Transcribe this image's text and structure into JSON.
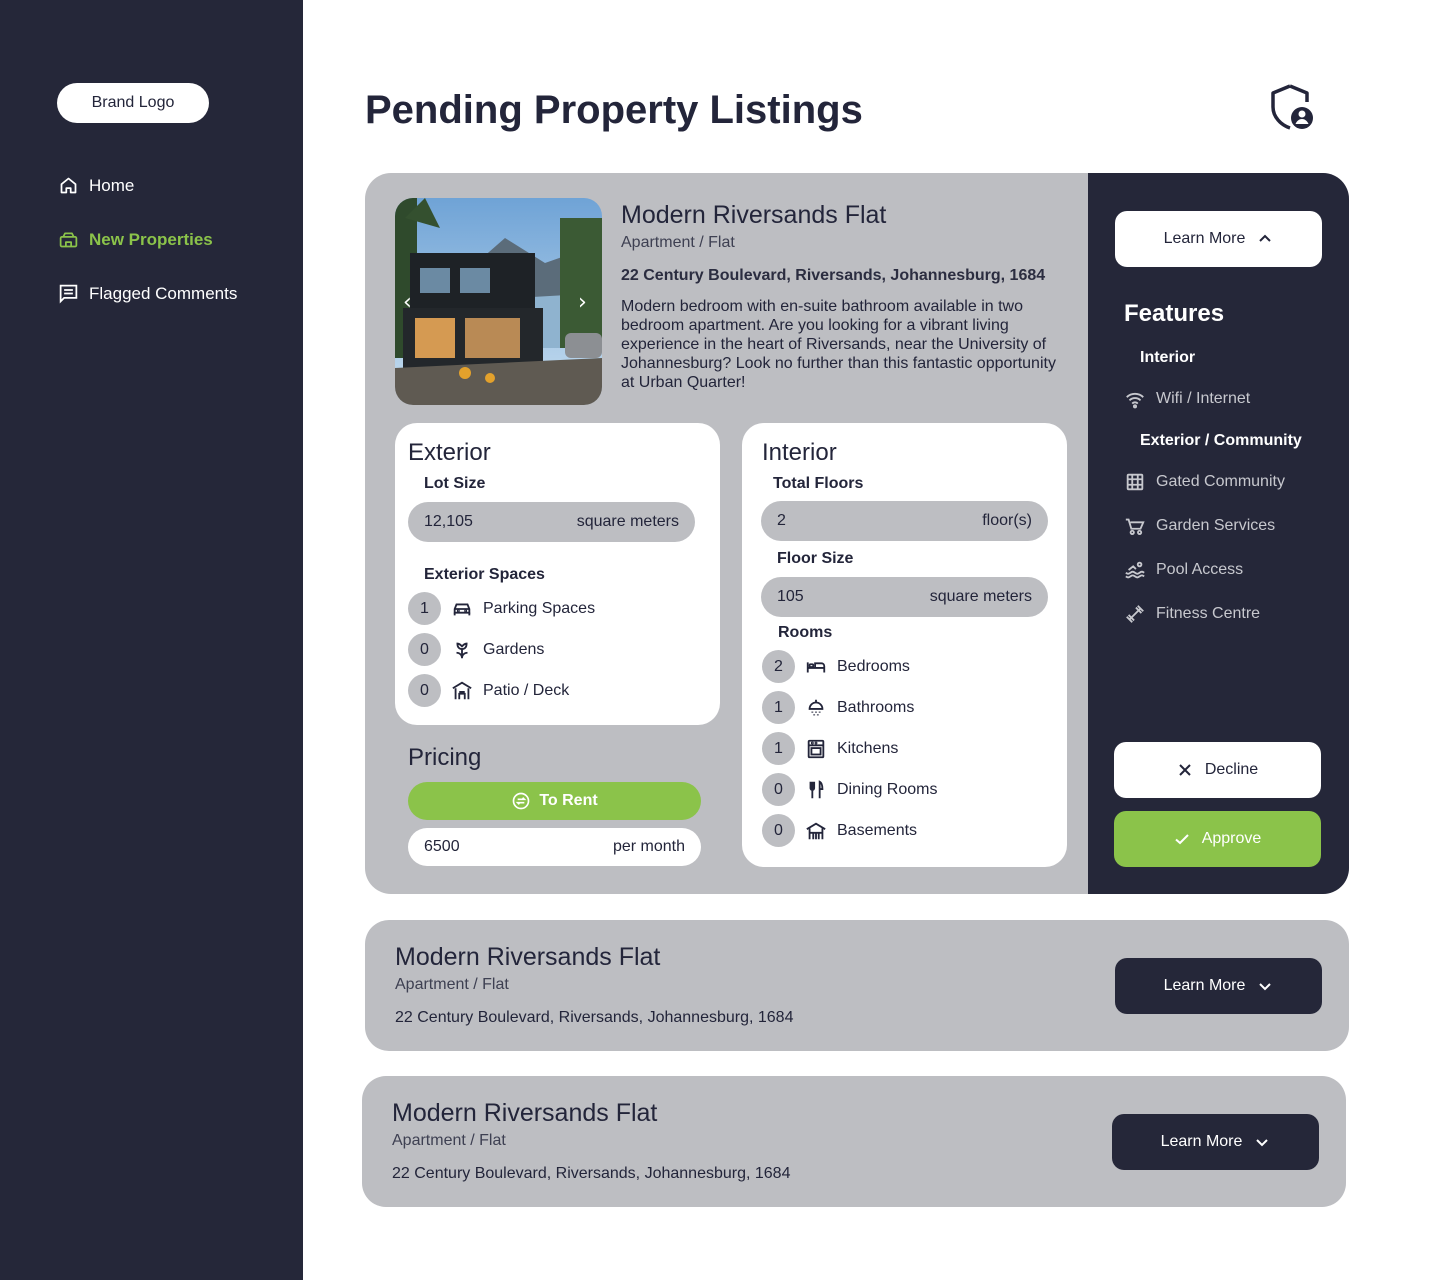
{
  "sidebar": {
    "brand_logo": "Brand Logo",
    "nav": [
      {
        "label": "Home",
        "icon": "home-icon",
        "active": false
      },
      {
        "label": "New Properties",
        "icon": "new-properties-icon",
        "active": true
      },
      {
        "label": "Flagged Comments",
        "icon": "comments-icon",
        "active": false
      }
    ]
  },
  "header": {
    "title": "Pending Property Listings",
    "admin_icon": "shield-user-icon"
  },
  "colors": {
    "sidebar_bg": "#252739",
    "accent_green": "#8bc34a",
    "card_bg": "#bdbec2",
    "text_dark": "#23253a"
  },
  "listing": {
    "title": "Modern Riversands Flat",
    "type": "Apartment / Flat",
    "address": "22 Century Boulevard, Riversands, Johannesburg, 1684",
    "description": "Modern bedroom with en-suite bathroom available in two bedroom apartment. Are you looking for a vibrant living experience in the  heart of Riversands, near the University of Johannesburg? Look no further than this fantastic opportunity at Urban Quarter!",
    "learn_more": "Learn More",
    "exterior": {
      "title": "Exterior",
      "lot_size_label": "Lot Size",
      "lot_size_value": "12,105",
      "lot_size_unit": "square meters",
      "spaces_label": "Exterior Spaces",
      "spaces": [
        {
          "count": "1",
          "label": "Parking Spaces",
          "icon": "car-icon"
        },
        {
          "count": "0",
          "label": "Gardens",
          "icon": "flower-icon"
        },
        {
          "count": "0",
          "label": "Patio / Deck",
          "icon": "patio-icon"
        }
      ]
    },
    "interior": {
      "title": "Interior",
      "total_floors_label": "Total Floors",
      "total_floors_value": "2",
      "total_floors_unit": "floor(s)",
      "floor_size_label": "Floor Size",
      "floor_size_value": "105",
      "floor_size_unit": "square meters",
      "rooms_label": "Rooms",
      "rooms": [
        {
          "count": "2",
          "label": "Bedrooms",
          "icon": "bed-icon"
        },
        {
          "count": "1",
          "label": "Bathrooms",
          "icon": "shower-icon"
        },
        {
          "count": "1",
          "label": "Kitchens",
          "icon": "oven-icon"
        },
        {
          "count": "0",
          "label": "Dining Rooms",
          "icon": "cutlery-icon"
        },
        {
          "count": "0",
          "label": "Basements",
          "icon": "basement-icon"
        }
      ]
    },
    "pricing": {
      "title": "Pricing",
      "mode": "To Rent",
      "amount": "6500",
      "period": "per month"
    },
    "features": {
      "title": "Features",
      "interior_label": "Interior",
      "interior_items": [
        {
          "label": "Wifi / Internet",
          "icon": "wifi-icon"
        }
      ],
      "exterior_label": "Exterior / Community",
      "exterior_items": [
        {
          "label": "Gated Community",
          "icon": "gate-icon"
        },
        {
          "label": "Garden Services",
          "icon": "wheelbarrow-icon"
        },
        {
          "label": "Pool Access",
          "icon": "pool-icon"
        },
        {
          "label": "Fitness Centre",
          "icon": "dumbbell-icon"
        }
      ]
    },
    "decline": "Decline",
    "approve": "Approve"
  },
  "collapsed_listings": [
    {
      "title": "Modern Riversands Flat",
      "type": "Apartment / Flat",
      "address": "22 Century Boulevard, Riversands, Johannesburg, 1684",
      "learn_more": "Learn More"
    },
    {
      "title": "Modern Riversands Flat",
      "type": "Apartment / Flat",
      "address": "22 Century Boulevard, Riversands, Johannesburg, 1684",
      "learn_more": "Learn More"
    }
  ]
}
